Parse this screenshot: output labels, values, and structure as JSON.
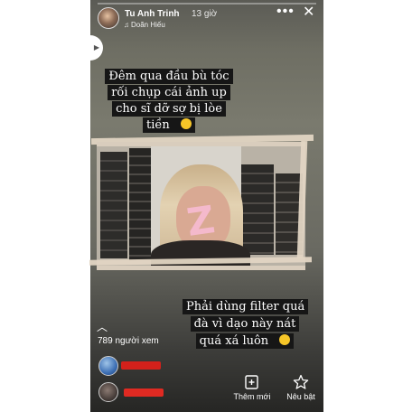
{
  "story": {
    "user_name": "Tu Anh Trinh",
    "time_ago": "13 giờ",
    "music_artist": "Doãn Hiếu",
    "more_icon": "more-horizontal-icon",
    "close_icon": "close-icon",
    "caption_top": "Đêm qua đầu bù tóc rối chụp cái ảnh up cho sĩ dỡ sợ bị lòe tiền",
    "caption_bottom": "Phải dùng filter quá đà vì dạo này nát quá xá luôn"
  },
  "footer": {
    "viewer_count": "789 người xem",
    "new_label": "Thêm mới",
    "highlight_label": "Nêu bật"
  },
  "colors": {
    "caption_bg": "#161616",
    "hidden_name_red": "#d3211b",
    "sticker_pink": "#f4b9cc"
  }
}
